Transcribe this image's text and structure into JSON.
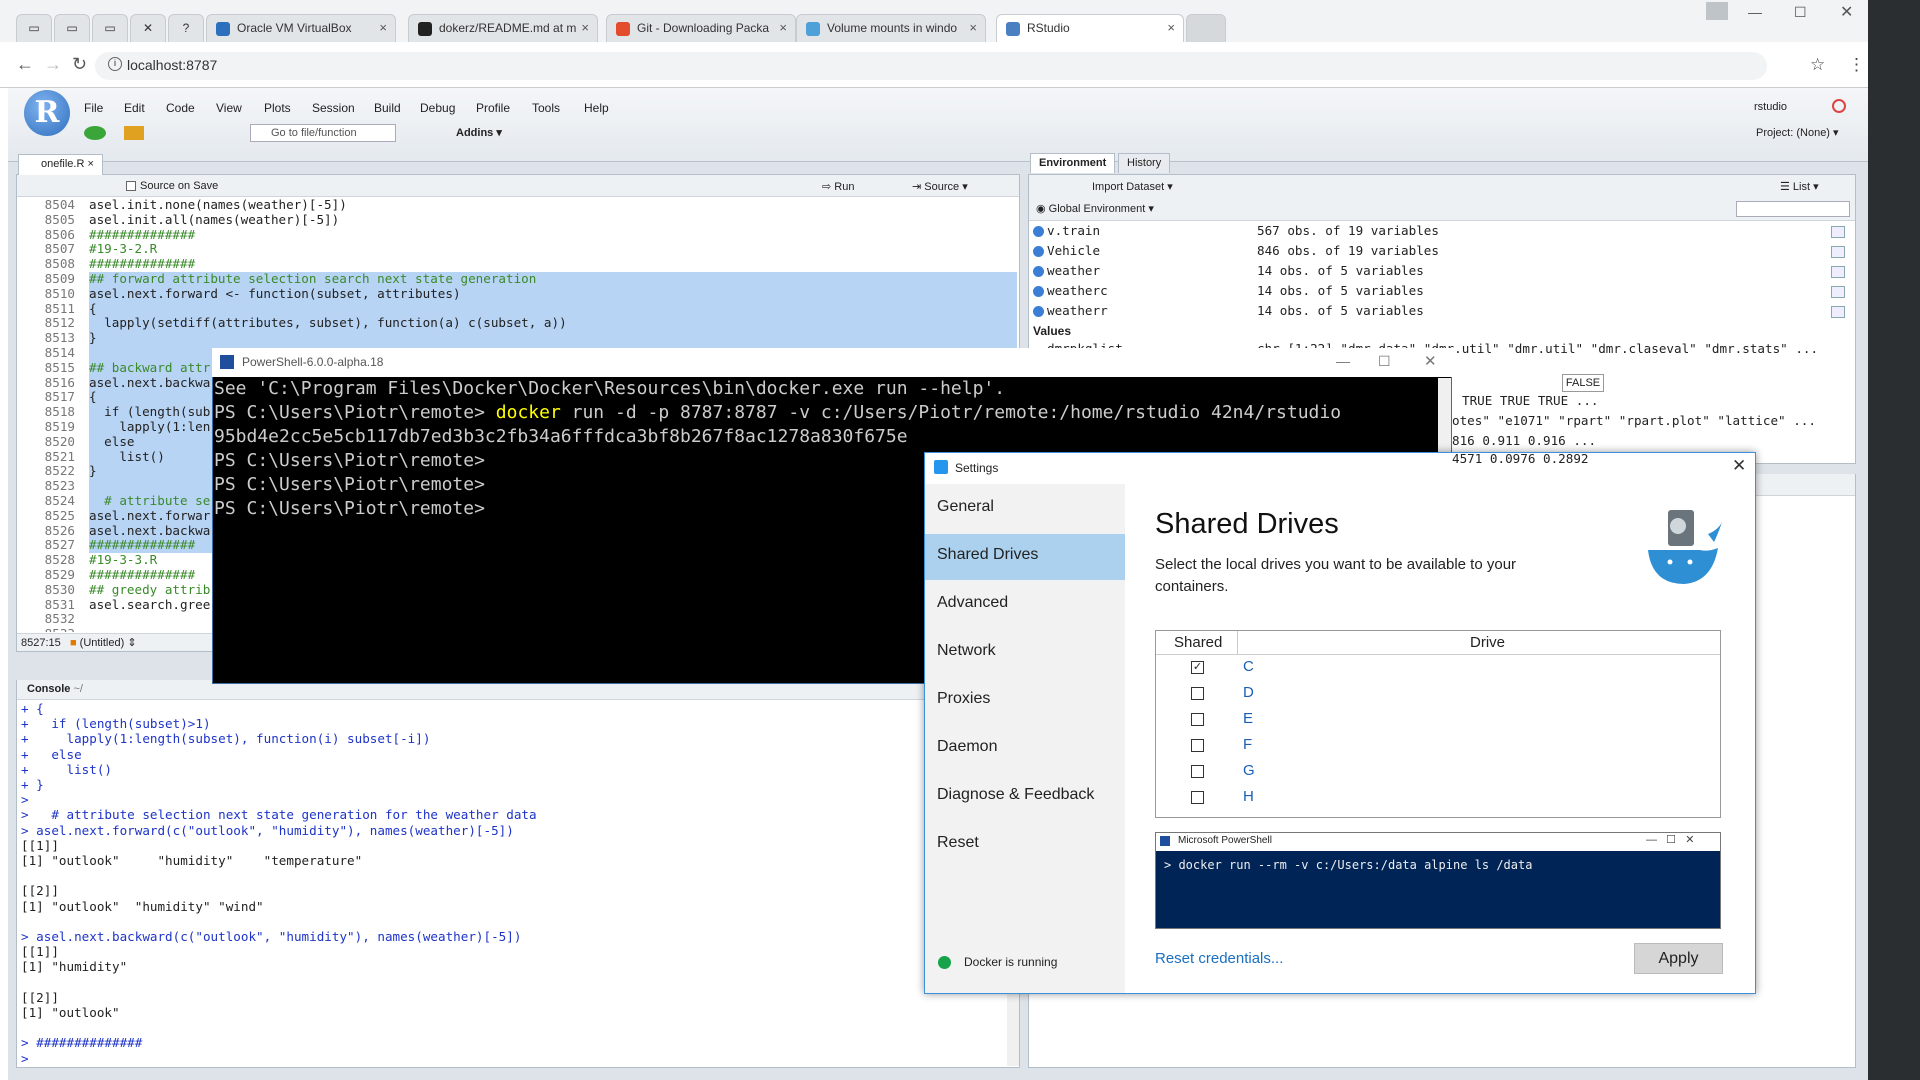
{
  "browser": {
    "tabs": [
      {
        "label": "Oracle VM VirtualBox",
        "color": "#2b6fbd"
      },
      {
        "label": "dokerz/README.md at m",
        "color": "#222222"
      },
      {
        "label": "Git - Downloading Packa",
        "color": "#e24b2c"
      },
      {
        "label": "Volume mounts in windo",
        "color": "#4da0d8"
      },
      {
        "label": "RStudio",
        "color": "#4a7fc1"
      }
    ],
    "url": "localhost:8787"
  },
  "rstudio": {
    "menu": [
      "File",
      "Edit",
      "Code",
      "View",
      "Plots",
      "Session",
      "Build",
      "Debug",
      "Profile",
      "Tools",
      "Help"
    ],
    "goto": "Go to file/function",
    "addins": "Addins",
    "user": "rstudio",
    "project": "Project: (None)",
    "editor_tab": "onefile.R",
    "source_on_save": "Source on Save",
    "run": "Run",
    "source": "Source",
    "status_pos": "8527:15",
    "status_ctx": "(Untitled)",
    "editor_lines": [
      {
        "n": "8504",
        "t": "asel.init.none(names(weather)[-5])",
        "s": false
      },
      {
        "n": "8505",
        "t": "asel.init.all(names(weather)[-5])",
        "s": false
      },
      {
        "n": "8506",
        "t": "##############",
        "s": false
      },
      {
        "n": "8507",
        "t": "#19-3-2.R",
        "s": false
      },
      {
        "n": "8508",
        "t": "##############",
        "s": false
      },
      {
        "n": "8509",
        "t": "## forward attribute selection search next state generation",
        "s": true
      },
      {
        "n": "8510",
        "t": "asel.next.forward <- function(subset, attributes)",
        "s": true
      },
      {
        "n": "8511",
        "t": "{",
        "s": true
      },
      {
        "n": "8512",
        "t": "  lapply(setdiff(attributes, subset), function(a) c(subset, a))",
        "s": true
      },
      {
        "n": "8513",
        "t": "}",
        "s": true
      },
      {
        "n": "8514",
        "t": "",
        "s": true
      },
      {
        "n": "8515",
        "t": "## backward attr",
        "s": true
      },
      {
        "n": "8516",
        "t": "asel.next.backwa",
        "s": true
      },
      {
        "n": "8517",
        "t": "{",
        "s": true
      },
      {
        "n": "8518",
        "t": "  if (length(sub",
        "s": true
      },
      {
        "n": "8519",
        "t": "    lapply(1:len",
        "s": true
      },
      {
        "n": "8520",
        "t": "  else",
        "s": true
      },
      {
        "n": "8521",
        "t": "    list()",
        "s": true
      },
      {
        "n": "8522",
        "t": "}",
        "s": true
      },
      {
        "n": "8523",
        "t": "",
        "s": true
      },
      {
        "n": "8524",
        "t": "  # attribute se",
        "s": true
      },
      {
        "n": "8525",
        "t": "asel.next.forwar",
        "s": true
      },
      {
        "n": "8526",
        "t": "asel.next.backwa",
        "s": true
      },
      {
        "n": "8527",
        "t": "##############",
        "s": true
      },
      {
        "n": "8528",
        "t": "#19-3-3.R",
        "s": false
      },
      {
        "n": "8529",
        "t": "##############",
        "s": false
      },
      {
        "n": "8530",
        "t": "## greedy attrib",
        "s": false
      },
      {
        "n": "8531",
        "t": "asel.search.gree",
        "s": false
      },
      {
        "n": "8532",
        "t": "",
        "s": false
      },
      {
        "n": "8533",
        "t": "",
        "s": false
      }
    ],
    "console_title": "Console",
    "console_path": "~/",
    "console_lines": [
      "+ {",
      "+   if (length(subset)>1)",
      "+     lapply(1:length(subset), function(i) subset[-i])",
      "+   else",
      "+     list()",
      "+ }",
      ">",
      ">   # attribute selection next state generation for the weather data",
      "> asel.next.forward(c(\"outlook\", \"humidity\"), names(weather)[-5])",
      "[[1]]",
      "[1] \"outlook\"     \"humidity\"    \"temperature\"",
      "",
      "[[2]]",
      "[1] \"outlook\"  \"humidity\" \"wind\"",
      "",
      "> asel.next.backward(c(\"outlook\", \"humidity\"), names(weather)[-5])",
      "[[1]]",
      "[1] \"humidity\"",
      "",
      "[[2]]",
      "[1] \"outlook\"",
      "",
      "> ##############",
      ">"
    ],
    "env_tabs": [
      "Environment",
      "History"
    ],
    "import_dataset": "Import Dataset",
    "list_label": "List",
    "global_env": "Global Environment",
    "env_rows": [
      {
        "name": "v.train",
        "value": "567 obs. of 19 variables"
      },
      {
        "name": "Vehicle",
        "value": "846 obs. of 19 variables"
      },
      {
        "name": "weather",
        "value": "14 obs. of 5 variables"
      },
      {
        "name": "weatherc",
        "value": "14 obs. of 5 variables"
      },
      {
        "name": "weatherr",
        "value": "14 obs. of 5 variables"
      }
    ],
    "values_header": "Values",
    "values_rows": [
      {
        "name": "dmrpkglist",
        "value": "chr [1:22] \"dmr.data\" \"dmr.util\" \"dmr.util\" \"dmr.claseval\" \"dmr.stats\" ..."
      }
    ],
    "partial_rows": [
      "TRUE TRUE TRUE ...",
      "otes\" \"e1071\" \"rpart\" \"rpart.plot\" \"lattice\" ...",
      "816 0.911 0.916 ...",
      "4571 0.0976 0.2892"
    ],
    "tooltip": "FALSE"
  },
  "powershell": {
    "title": "PowerShell-6.0.0-alpha.18",
    "lines": [
      {
        "t": "See 'C:\\Program Files\\Docker\\Docker\\Resources\\bin\\docker.exe run --help'.",
        "k": "plain"
      },
      {
        "prompt": "PS C:\\Users\\Piotr\\remote> ",
        "cmd": "docker",
        "rest": " run -d -p 8787:8787 -v c:/Users/Piotr/remote:/home/rstudio 42n4/rstudio",
        "k": "cmd"
      },
      {
        "t": "95bd4e2cc5e5cb117db7ed3b3c2fb34a6fffdca3bf8b267f8ac1278a830f675e",
        "k": "plain"
      },
      {
        "t": "PS C:\\Users\\Piotr\\remote>",
        "k": "plain"
      },
      {
        "t": "PS C:\\Users\\Piotr\\remote>",
        "k": "plain"
      },
      {
        "t": "PS C:\\Users\\Piotr\\remote>",
        "k": "plain"
      }
    ]
  },
  "settings": {
    "title": "Settings",
    "nav": [
      "General",
      "Shared Drives",
      "Advanced",
      "Network",
      "Proxies",
      "Daemon",
      "Diagnose & Feedback",
      "Reset"
    ],
    "active": "Shared Drives",
    "heading": "Shared Drives",
    "description": "Select the local drives you want to be available to your containers.",
    "col_shared": "Shared",
    "col_drive": "Drive",
    "drives": [
      {
        "letter": "C",
        "checked": true
      },
      {
        "letter": "D",
        "checked": false
      },
      {
        "letter": "E",
        "checked": false
      },
      {
        "letter": "F",
        "checked": false
      },
      {
        "letter": "G",
        "checked": false
      },
      {
        "letter": "H",
        "checked": false
      }
    ],
    "ps_title": "Microsoft PowerShell",
    "ps_command": "> docker run --rm -v c:/Users:/data alpine ls /data",
    "reset_link": "Reset credentials...",
    "apply": "Apply",
    "status": "Docker is running",
    "status_color": "#16a34a"
  }
}
